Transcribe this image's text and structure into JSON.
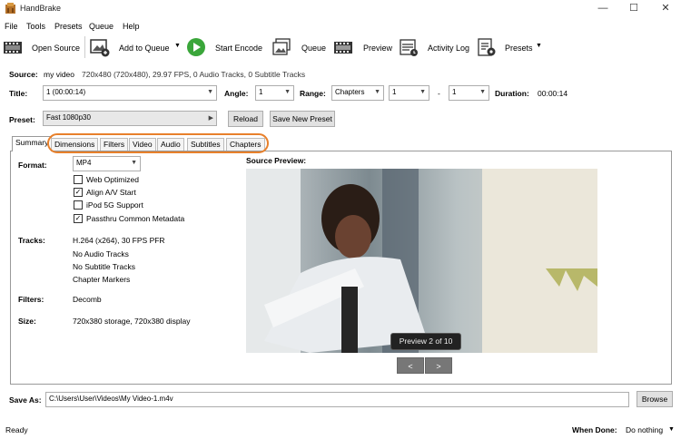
{
  "window": {
    "title": "HandBrake",
    "minimize": "—",
    "maximize": "☐",
    "close": "✕"
  },
  "menu": [
    "File",
    "Tools",
    "Presets",
    "Queue",
    "Help"
  ],
  "toolbar": {
    "open_source": "Open Source",
    "add_to_queue": "Add to Queue",
    "start_encode": "Start Encode",
    "queue": "Queue",
    "preview": "Preview",
    "activity_log": "Activity Log",
    "presets": "Presets"
  },
  "source": {
    "label": "Source:",
    "name": "my video",
    "info": "720x480 (720x480), 29.97 FPS, 0 Audio Tracks, 0 Subtitle Tracks"
  },
  "title_row": {
    "title_label": "Title:",
    "title_value": "1 (00:00:14)",
    "angle_label": "Angle:",
    "angle_value": "1",
    "range_label": "Range:",
    "range_type": "Chapters",
    "range_start": "1",
    "range_sep": "-",
    "range_end": "1",
    "duration_label": "Duration:",
    "duration_value": "00:00:14"
  },
  "preset_row": {
    "label": "Preset:",
    "value": "Fast 1080p30",
    "reload": "Reload",
    "save_new": "Save New Preset"
  },
  "tabs": [
    "Summary",
    "Dimensions",
    "Filters",
    "Video",
    "Audio",
    "Subtitles",
    "Chapters"
  ],
  "summary": {
    "format_label": "Format:",
    "format_value": "MP4",
    "checkboxes": [
      {
        "label": "Web Optimized",
        "checked": false
      },
      {
        "label": "Align A/V Start",
        "checked": true
      },
      {
        "label": "iPod 5G Support",
        "checked": false
      },
      {
        "label": "Passthru Common Metadata",
        "checked": true
      }
    ],
    "tracks_label": "Tracks:",
    "tracks": [
      "H.264 (x264), 30 FPS PFR",
      "No Audio Tracks",
      "No Subtitle Tracks",
      "Chapter Markers"
    ],
    "filters_label": "Filters:",
    "filters_value": "Decomb",
    "size_label": "Size:",
    "size_value": "720x380 storage, 720x380 display"
  },
  "preview": {
    "label": "Source Preview:",
    "badge": "Preview 2 of 10",
    "prev": "<",
    "next": ">"
  },
  "save_as": {
    "label": "Save As:",
    "path": "C:\\Users\\User\\Videos\\My Video-1.m4v",
    "browse": "Browse"
  },
  "status": {
    "text": "Ready",
    "when_done_label": "When Done:",
    "when_done_value": "Do nothing"
  },
  "colors": {
    "highlight": "#e8802b",
    "accent_green": "#3aa63a"
  }
}
